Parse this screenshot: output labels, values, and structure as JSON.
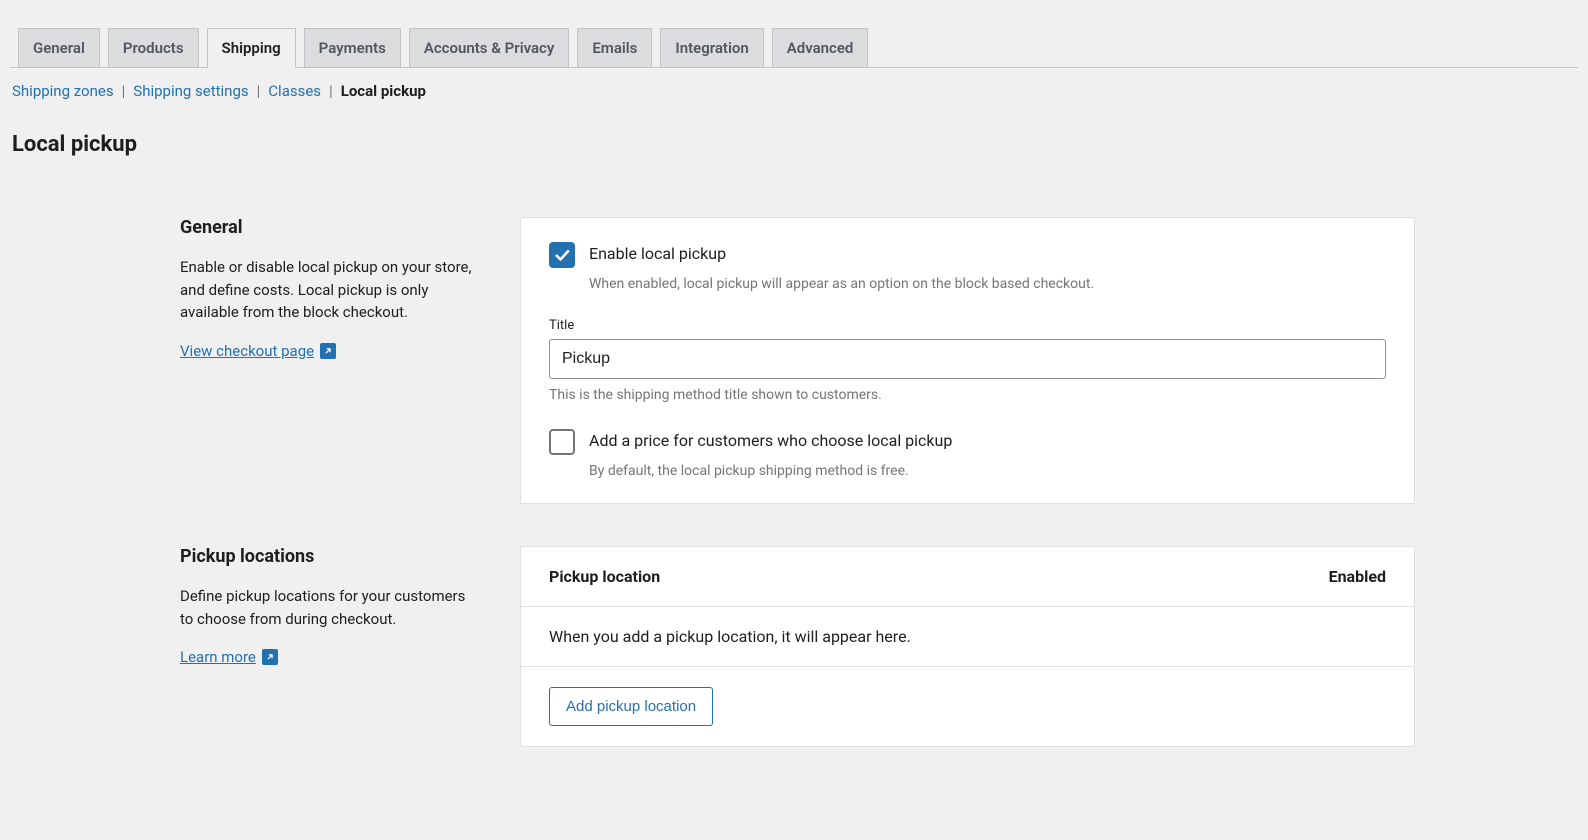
{
  "tabs": {
    "general": "General",
    "products": "Products",
    "shipping": "Shipping",
    "payments": "Payments",
    "accounts": "Accounts & Privacy",
    "emails": "Emails",
    "integration": "Integration",
    "advanced": "Advanced"
  },
  "subnav": {
    "zones": "Shipping zones",
    "settings": "Shipping settings",
    "classes": "Classes",
    "current": "Local pickup"
  },
  "page_title": "Local pickup",
  "general_section": {
    "heading": "General",
    "desc": "Enable or disable local pickup on your store, and define costs. Local pickup is only available from the block checkout.",
    "link": "View checkout page"
  },
  "enable": {
    "label": "Enable local pickup",
    "help": "When enabled, local pickup will appear as an option on the block based checkout."
  },
  "title_field": {
    "label": "Title",
    "value": "Pickup",
    "help": "This is the shipping method title shown to customers."
  },
  "price": {
    "label": "Add a price for customers who choose local pickup",
    "help": "By default, the local pickup shipping method is free."
  },
  "locations_section": {
    "heading": "Pickup locations",
    "desc": "Define pickup locations for your customers to choose from during checkout.",
    "link": "Learn more"
  },
  "locations_table": {
    "col_location": "Pickup location",
    "col_enabled": "Enabled",
    "empty": "When you add a pickup location, it will appear here.",
    "add_button": "Add pickup location"
  }
}
